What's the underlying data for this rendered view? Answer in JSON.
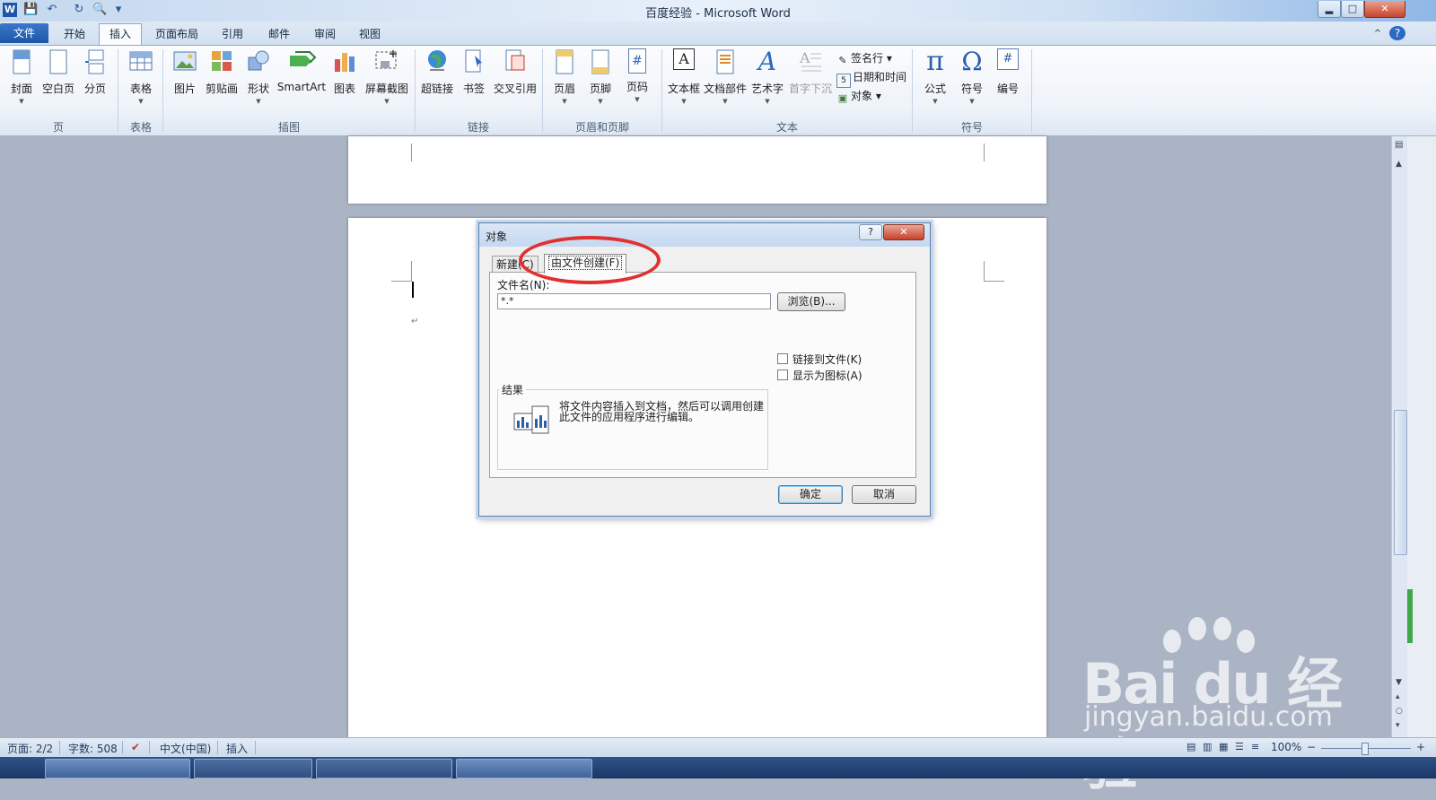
{
  "window": {
    "title": "百度经验 - Microsoft Word",
    "minimize": "▂",
    "maximize": "□",
    "close": "✕"
  },
  "quick_access": {
    "app_icon": "W",
    "save_icon": "💾",
    "undo_icon": "↶",
    "redo_icon": "↻",
    "print_preview_icon": "🔍",
    "customize_icon": "▾"
  },
  "tabs": [
    {
      "label": "文件"
    },
    {
      "label": "开始"
    },
    {
      "label": "插入"
    },
    {
      "label": "页面布局"
    },
    {
      "label": "引用"
    },
    {
      "label": "邮件"
    },
    {
      "label": "审阅"
    },
    {
      "label": "视图"
    }
  ],
  "ribbon": {
    "groups": {
      "pages": "页",
      "tables": "表格",
      "illustrations": "插图",
      "links": "链接",
      "header_footer": "页眉和页脚",
      "text": "文本",
      "symbols": "符号"
    },
    "buttons": {
      "cover": "封面",
      "blank_page": "空白页",
      "page_break": "分页",
      "table": "表格",
      "picture": "图片",
      "clipart": "剪贴画",
      "shapes": "形状",
      "smartart": "SmartArt",
      "chart": "图表",
      "screenshot": "屏幕截图",
      "hyperlink": "超链接",
      "bookmark": "书签",
      "cross_ref": "交叉引用",
      "header": "页眉",
      "footer": "页脚",
      "page_number": "页码",
      "textbox": "文本框",
      "quick_parts": "文档部件",
      "wordart": "艺术字",
      "dropcap": "首字下沉",
      "signature_line": "签名行 ▾",
      "date_time": "日期和时间",
      "object": "对象 ▾",
      "equation": "公式",
      "symbol": "符号",
      "numbering": "编号"
    },
    "glyphs": {
      "equation": "π",
      "symbol": "Ω",
      "numbering": "#",
      "wordart": "A",
      "textbox": "A",
      "page_number": "#"
    }
  },
  "dialog": {
    "title": "对象",
    "help": "?",
    "close": "✕",
    "tabs": {
      "new": "新建(C)",
      "from_file": "由文件创建(F)"
    },
    "file_name_label": "文件名(N):",
    "file_name_value": "*.*",
    "browse": "浏览(B)...",
    "link_to_file": "链接到文件(K)",
    "display_as_icon": "显示为图标(A)",
    "result_label": "结果",
    "result_text": "将文件内容插入到文档，然后可以调用创建此文件的应用程序进行编辑。",
    "ok": "确定",
    "cancel": "取消"
  },
  "document": {
    "paragraph_mark": "↵"
  },
  "status": {
    "page": "页面: 2/2",
    "words": "字数: 508",
    "proofing_icon": "✔",
    "language": "中文(中国)",
    "mode": "插入",
    "zoom": "100%",
    "zoom_minus": "−",
    "zoom_plus": "+"
  },
  "watermark": {
    "logo": "Bai du 经验",
    "url": "jingyan.baidu.com"
  },
  "colors": {
    "accent": "#1d56a8",
    "highlight": "#e03131"
  }
}
